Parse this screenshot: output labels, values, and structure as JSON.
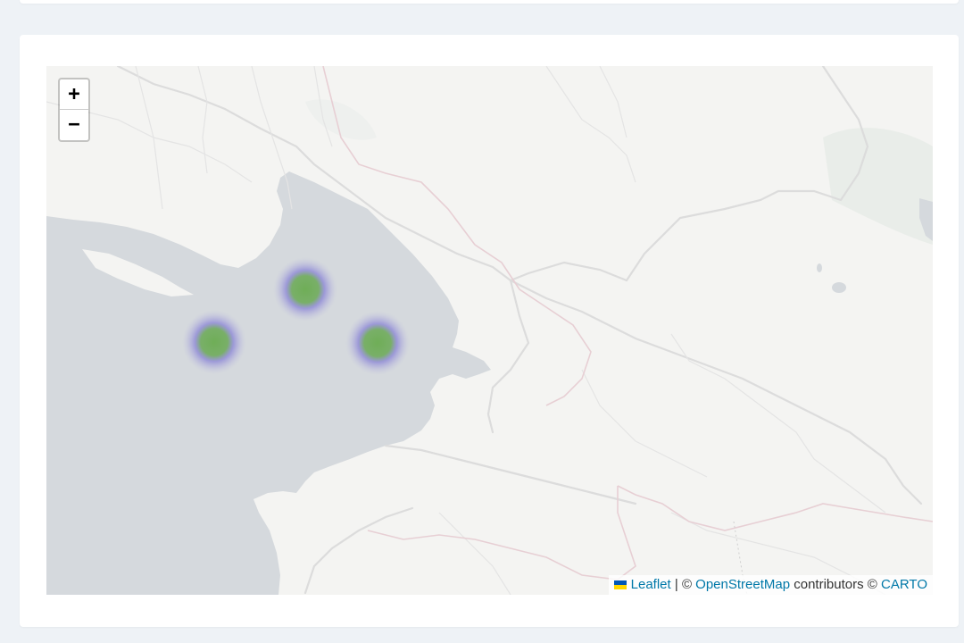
{
  "map": {
    "zoom_in_label": "+",
    "zoom_out_label": "−",
    "heat_colors": {
      "core": "#6fae57",
      "halo": "#8a84d6"
    },
    "attribution": {
      "leaflet": "Leaflet",
      "separator": "|",
      "copyright_1": "©",
      "osm": "OpenStreetMap",
      "contributors": "contributors",
      "copyright_2": "©",
      "carto": "CARTO"
    },
    "icons": {
      "flag": "ukraine-flag-icon"
    }
  }
}
